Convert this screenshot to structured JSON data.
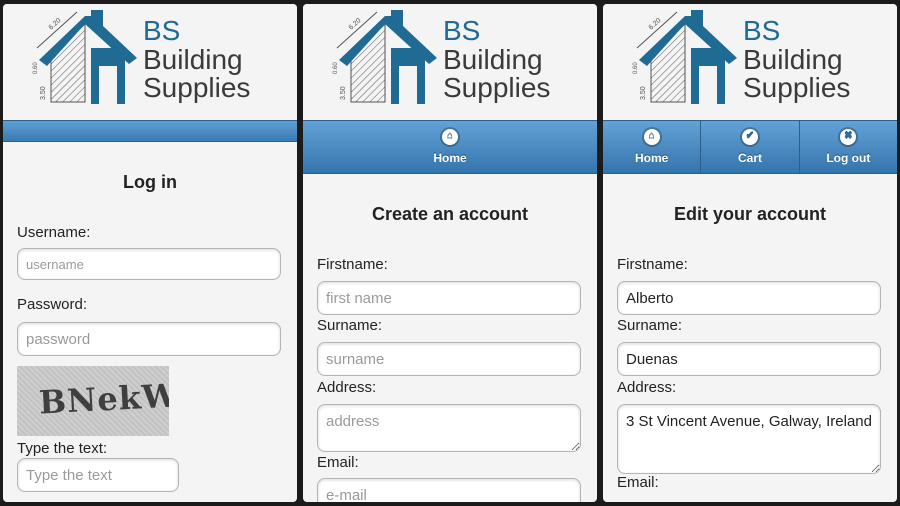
{
  "logo": {
    "initials": "BS",
    "line1": "Building",
    "line2": "Supplies",
    "dim_top": "6.20",
    "dim_left": "3.50",
    "dim_mid": "0.60"
  },
  "login": {
    "title": "Log in",
    "username_label": "Username:",
    "username_placeholder": "username",
    "password_label": "Password:",
    "password_placeholder": "password",
    "captcha_text": "BNekW",
    "captcha_label": "Type the text:",
    "captcha_placeholder": "Type the text"
  },
  "create": {
    "nav": [
      {
        "label": "Home",
        "icon": "home-icon"
      }
    ],
    "title": "Create an account",
    "firstname_label": "Firstname:",
    "firstname_placeholder": "first name",
    "surname_label": "Surname:",
    "surname_placeholder": "surname",
    "address_label": "Address:",
    "address_placeholder": "address",
    "email_label": "Email:",
    "email_placeholder": "e-mail"
  },
  "edit": {
    "nav": [
      {
        "label": "Home",
        "icon": "home-icon"
      },
      {
        "label": "Cart",
        "icon": "check-icon"
      },
      {
        "label": "Log out",
        "icon": "close-icon"
      }
    ],
    "title": "Edit your account",
    "firstname_label": "Firstname:",
    "firstname_value": "Alberto",
    "surname_label": "Surname:",
    "surname_value": "Duenas",
    "address_label": "Address:",
    "address_value": "3 St Vincent Avenue, Galway, Ireland",
    "email_label": "Email:"
  },
  "colors": {
    "brand_blue": "#1f6b94",
    "navbar": "#4a8cc4",
    "panel_bg": "#f4f4f4"
  }
}
